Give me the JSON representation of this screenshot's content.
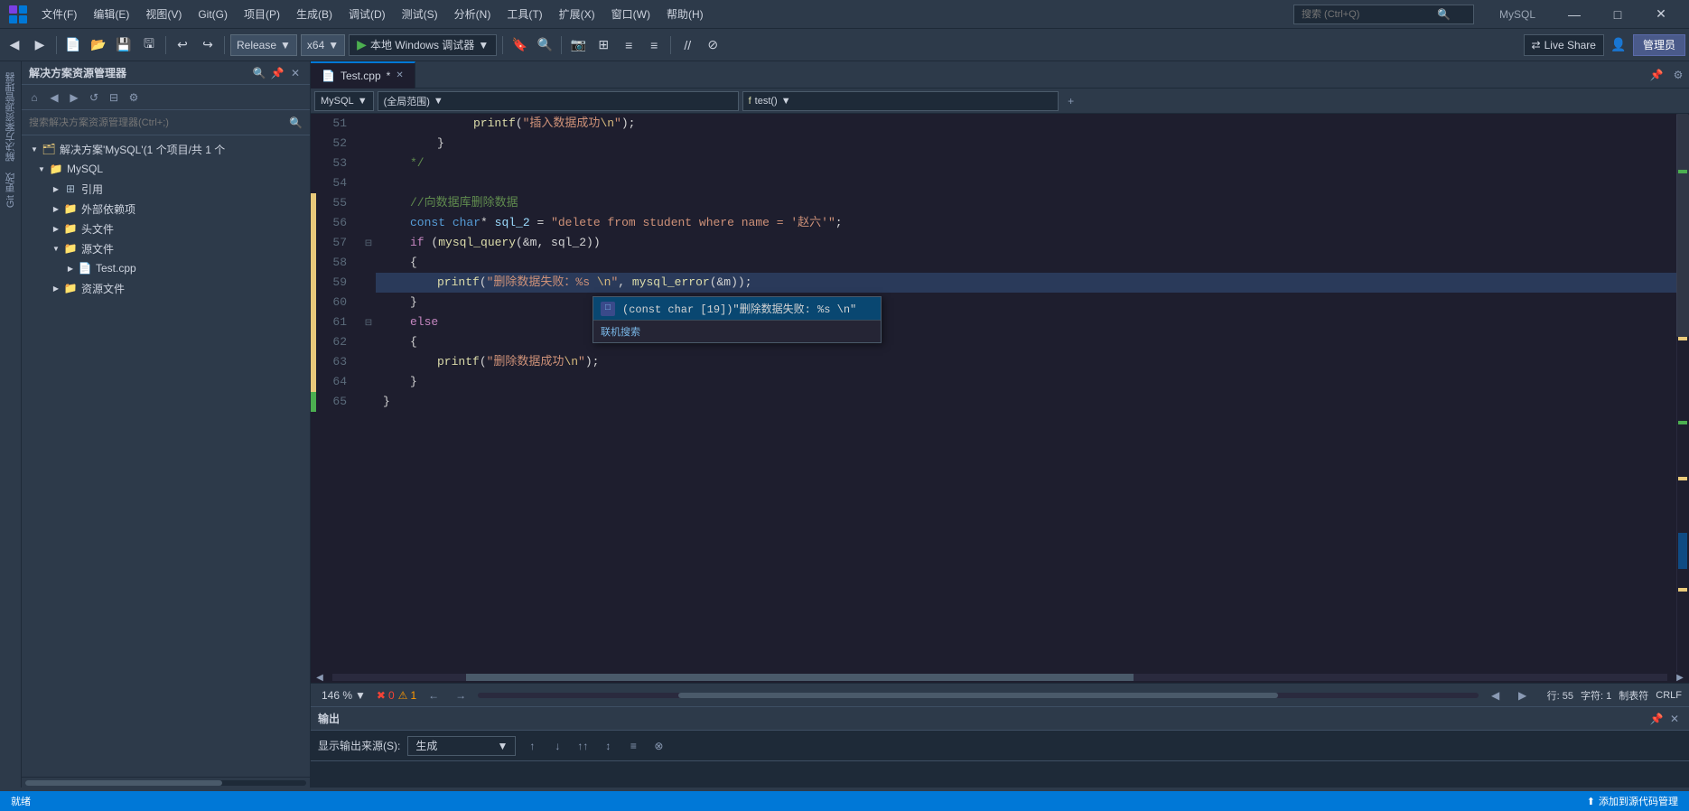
{
  "titlebar": {
    "logo": "VS",
    "menus": [
      "文件(F)",
      "编辑(E)",
      "视图(V)",
      "Git(G)",
      "项目(P)",
      "生成(B)",
      "调试(D)",
      "测试(S)",
      "分析(N)",
      "工具(T)",
      "扩展(X)",
      "窗口(W)",
      "帮助(H)"
    ],
    "search_placeholder": "搜索 (Ctrl+Q)",
    "window_title": "MySQL",
    "minimize": "—",
    "maximize": "□",
    "close": "✕"
  },
  "toolbar": {
    "config": "Release",
    "platform": "x64",
    "run_label": "本地 Windows 调试器",
    "liveshare": "Live Share",
    "manage": "管理员"
  },
  "sidebar": {
    "title": "解决方案资源管理器",
    "search_placeholder": "搜索解决方案资源管理器(Ctrl+;)",
    "solution_label": "解决方案'MySQL'(1 个项目/共 1 个",
    "items": [
      {
        "label": "MySQL",
        "level": 1,
        "type": "project",
        "expanded": true
      },
      {
        "label": "引用",
        "level": 2,
        "type": "folder",
        "expanded": false
      },
      {
        "label": "外部依赖项",
        "level": 2,
        "type": "folder",
        "expanded": false
      },
      {
        "label": "头文件",
        "level": 2,
        "type": "folder",
        "expanded": false
      },
      {
        "label": "源文件",
        "level": 2,
        "type": "folder",
        "expanded": true
      },
      {
        "label": "Test.cpp",
        "level": 3,
        "type": "file",
        "expanded": false
      },
      {
        "label": "资源文件",
        "level": 2,
        "type": "folder",
        "expanded": false
      }
    ]
  },
  "editor": {
    "tab_name": "Test.cpp",
    "tab_modified": true,
    "language_dropdown": "MySQL",
    "scope_dropdown": "(全局范围)",
    "function_dropdown": "test()",
    "lines": [
      {
        "num": 51,
        "indent": 6,
        "content": "printf(“插入数据成功\\n”);",
        "type": "printf_success_insert"
      },
      {
        "num": 52,
        "indent": 4,
        "content": "}",
        "type": "plain"
      },
      {
        "num": 53,
        "indent": 2,
        "content": "*/",
        "type": "comment_end"
      },
      {
        "num": 54,
        "indent": 0,
        "content": "",
        "type": "empty"
      },
      {
        "num": 55,
        "indent": 2,
        "content": "//向数据库删除数据",
        "type": "comment"
      },
      {
        "num": 56,
        "indent": 2,
        "content": "const char* sql_2 = “delete from student where name = ‘赵六’”;",
        "type": "declare"
      },
      {
        "num": 57,
        "indent": 2,
        "content": "if (mysql_query(&m, sql_2))",
        "type": "if"
      },
      {
        "num": 58,
        "indent": 2,
        "content": "{",
        "type": "brace"
      },
      {
        "num": 59,
        "indent": 4,
        "content": "printf(“删除数据失败：%s \\n”, mysql_error(&m));",
        "type": "printf_error"
      },
      {
        "num": 60,
        "indent": 2,
        "content": "}",
        "type": "brace"
      },
      {
        "num": 61,
        "indent": 2,
        "content": "else",
        "type": "else"
      },
      {
        "num": 62,
        "indent": 2,
        "content": "{",
        "type": "brace"
      },
      {
        "num": 63,
        "indent": 4,
        "content": "printf(“删除数据成功\\n”);",
        "type": "printf_success"
      },
      {
        "num": 64,
        "indent": 2,
        "content": "}",
        "type": "brace"
      },
      {
        "num": 65,
        "indent": 0,
        "content": "}",
        "type": "brace_close"
      }
    ],
    "autocomplete": {
      "visible": true,
      "items": [
        {
          "type": "const",
          "label": "(const char [19])\"删除数据失败: %s \\n\"",
          "selected": true
        },
        {
          "label": "联机搜索",
          "action": true
        }
      ]
    }
  },
  "statusbar": {
    "ready": "就绪",
    "errors": "0",
    "warnings": "1",
    "line": "行: 55",
    "column": "字符: 1",
    "tab": "制表符",
    "encoding": "CRLF",
    "zoom": "146 %",
    "source_control": "添加到源代码管理"
  },
  "output": {
    "title": "输出",
    "source_label": "显示输出来源(S):",
    "source_value": "生成"
  }
}
